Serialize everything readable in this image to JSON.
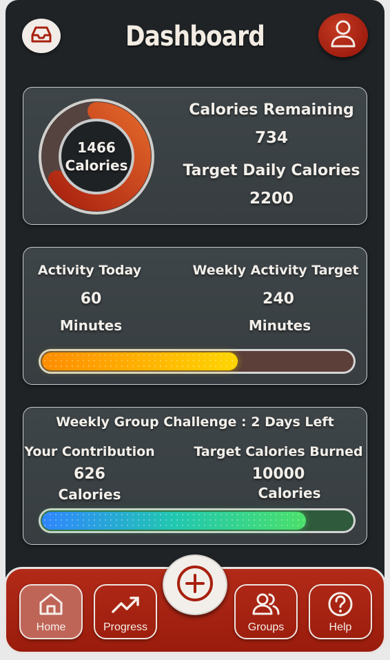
{
  "header": {
    "title": "Dashboard"
  },
  "calories_card": {
    "ring_value": "1466",
    "ring_unit": "Calories",
    "remaining_label": "Calories Remaining",
    "remaining_value": "734",
    "target_label": "Target Daily Calories",
    "target_value": "2200",
    "consumed_fraction": 0.666
  },
  "activity_card": {
    "today_label": "Activity Today",
    "today_value": "60",
    "today_unit": "Minutes",
    "target_label": "Weekly Activity Target",
    "target_value": "240",
    "target_unit": "Minutes",
    "progress_fraction": 0.63,
    "fill_colors": [
      "#ff8c00",
      "#ffd600"
    ],
    "track_color": "#5b3f38"
  },
  "challenge_card": {
    "title": "Weekly Group Challenge : 2 Days Left",
    "contribution_label": "Your Contribution",
    "contribution_value": "626",
    "contribution_unit": "Calories",
    "target_label": "Target Calories Burned",
    "target_value": "10000",
    "target_unit": "Calories",
    "progress_fraction": 0.85,
    "fill_colors": [
      "#2f86ff",
      "#21c7b0",
      "#4be06a"
    ],
    "track_color": "#2f5a3c"
  },
  "nav": {
    "items": [
      {
        "label": "Home",
        "icon": "home-icon"
      },
      {
        "label": "Progress",
        "icon": "trend-up-icon"
      },
      {
        "label": "Groups",
        "icon": "users-icon"
      },
      {
        "label": "Help",
        "icon": "help-icon"
      }
    ],
    "add_icon": "plus-circle-icon"
  },
  "colors": {
    "accent_red": "#a8200f",
    "background": "#1f2326",
    "card": "#3b4144"
  }
}
